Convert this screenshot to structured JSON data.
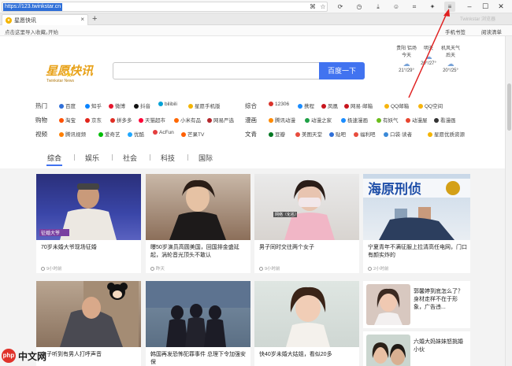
{
  "browser": {
    "url": "https://123.twinkstar.cn",
    "tab_title": "星愿快讯",
    "tab_close": "×",
    "new_tab": "+",
    "tab_right_text": "Twinkstar 浏览器",
    "bookmark_text": "点击这里导入收藏。",
    "bookmark_link": "开始",
    "bookmark_right": [
      "手机书签",
      "阅读清单"
    ],
    "toolbar_icons": [
      "qr-icon",
      "star-icon",
      "refresh-icon",
      "history-icon",
      "download-icon",
      "account-icon",
      "crop-icon",
      "extension-icon",
      "menu-icon"
    ],
    "window_icons": [
      "minimize-icon",
      "maximize-icon",
      "close-icon"
    ]
  },
  "header": {
    "logo_text": "星愿快讯",
    "logo_sub": "Twinkstar News",
    "search_placeholder": "",
    "search_button": "百度一下",
    "weather": [
      {
        "city": "贵阳 铝场",
        "day": "今天",
        "temp": "21°/29°"
      },
      {
        "city": "",
        "day": "明天",
        "temp": "20°/27°"
      },
      {
        "city": "机风天气",
        "day": "后天",
        "temp": "20°/25°"
      }
    ]
  },
  "nav": {
    "rows": [
      {
        "cat": "热门",
        "items": [
          "百度",
          "知乎",
          "微博",
          "抖音",
          "bilibili",
          "星愿手机版"
        ],
        "cat2": "综合",
        "items2": [
          "12306",
          "携程",
          "凤凰",
          "网易·邮箱",
          "QQ邮箱",
          "QQ空间"
        ]
      },
      {
        "cat": "购物",
        "items": [
          "淘宝",
          "京东",
          "拼多多",
          "天猫超市",
          "小米有品",
          "网易严选"
        ],
        "cat2": "漫画",
        "items2": [
          "腾讯动漫",
          "动漫之家",
          "极速漫画",
          "有妖气",
          "动漫屋",
          "看漫画"
        ]
      },
      {
        "cat": "视频",
        "items": [
          "腾讯视频",
          "爱奇艺",
          "优酷",
          "AcFun",
          "芒果TV"
        ],
        "cat2": "文青",
        "items2": [
          "豆瓣",
          "美图天堂",
          "贴吧",
          "福利吧",
          "口袋·读者",
          "星愿优质资源"
        ]
      }
    ]
  },
  "categories": [
    "综合",
    "娱乐",
    "社会",
    "科技",
    "国际"
  ],
  "cards": [
    {
      "title": "70岁未婚大爷现场征婚",
      "meta": "9小时前",
      "overlay": "征婚大爷"
    },
    {
      "title": "曝50岁演员高圆美国，回国排金盛延起，涡轮音光顶头不敢认",
      "meta": "昨天",
      "overlay": ""
    },
    {
      "title": "男子同时交往两个女子",
      "meta": "9小时前",
      "overlay": "网络（化名）"
    },
    {
      "title": "宁夏青年不满征服上拉清高任电网，门口有颜实炸的",
      "meta": "2小时前",
      "overlay": "海原刑侦"
    },
    {
      "title": "女子听到有男人打呼声音",
      "meta": "",
      "overlay": ""
    },
    {
      "title": "韩国再发恐怖犯罪事件 总理下令加强安保",
      "meta": "",
      "overlay": ""
    },
    {
      "title": "快40岁未婚大姑姐，看似20多",
      "meta": "",
      "overlay": ""
    }
  ],
  "side_cards": [
    {
      "title": "郭馨婷到底怎么了？身材走样不在于形象，广告违..."
    },
    {
      "title": "六婚大妈妹妹怒挑婚小伙"
    }
  ],
  "watermark": {
    "logo": "php",
    "text": "中文网"
  }
}
